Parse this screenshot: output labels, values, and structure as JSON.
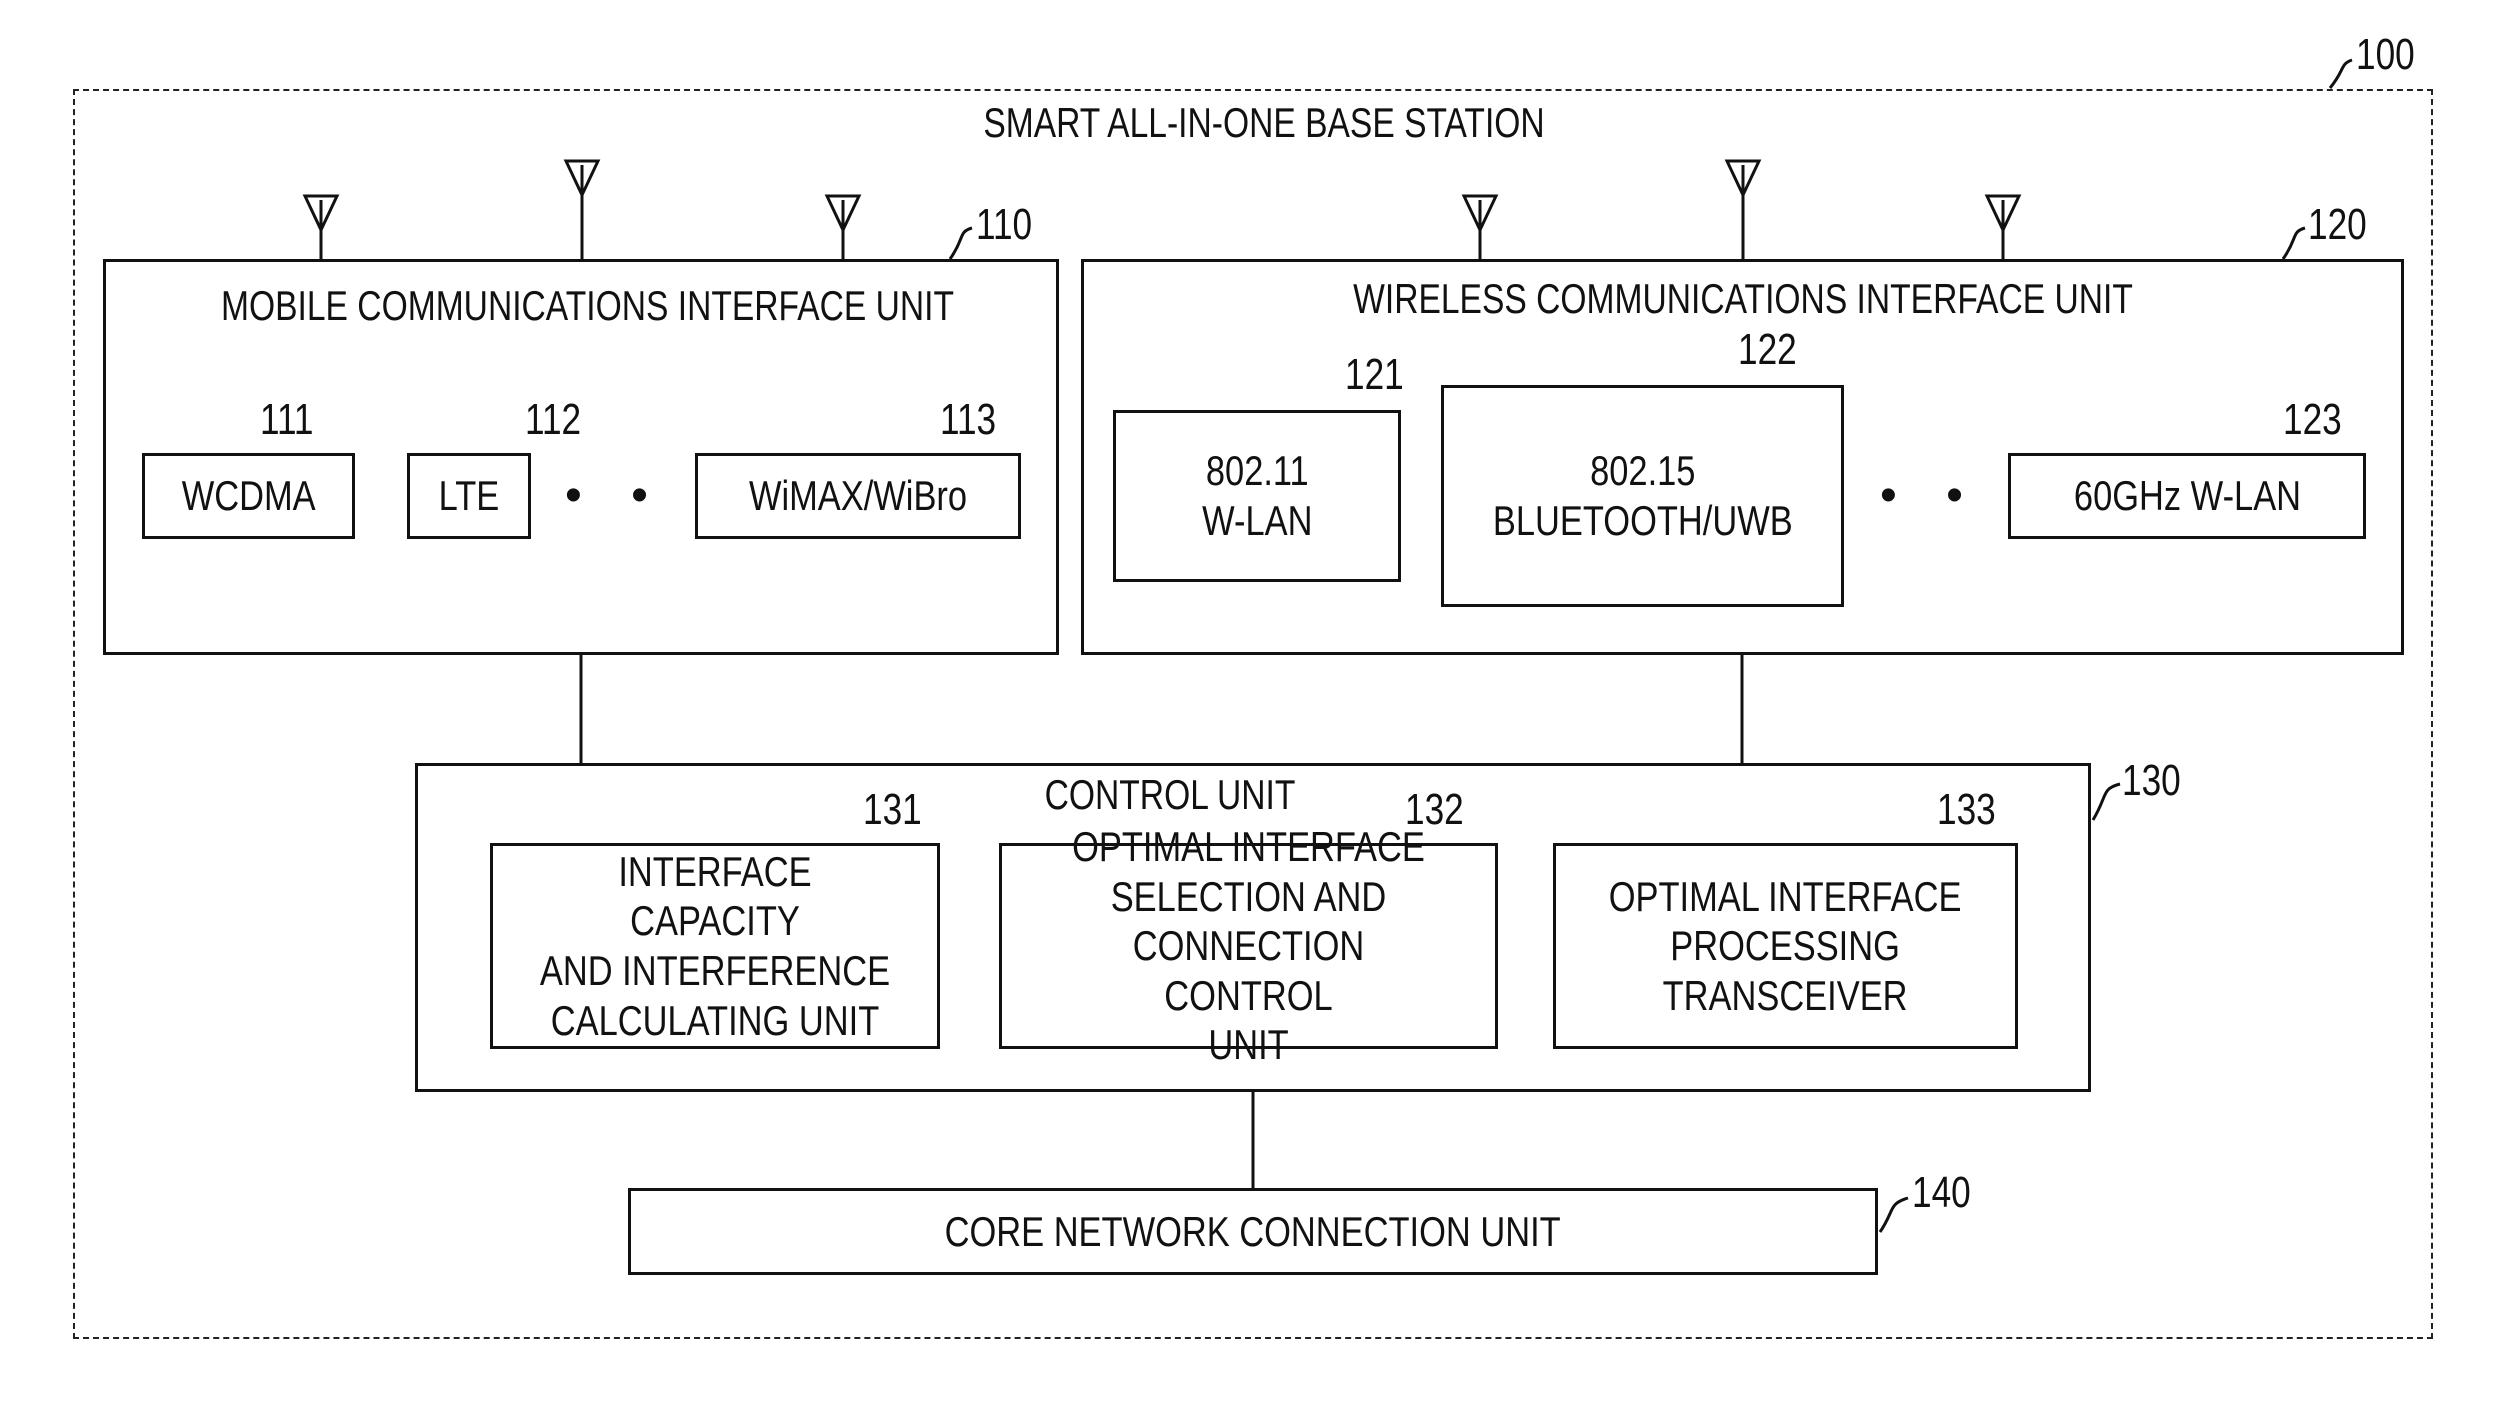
{
  "diagram": {
    "system": {
      "ref": "100",
      "title": "SMART ALL-IN-ONE BASE STATION"
    },
    "mobile_unit": {
      "ref": "110",
      "title": "MOBILE COMMUNICATIONS INTERFACE UNIT",
      "modules": [
        {
          "ref": "111",
          "label": "WCDMA"
        },
        {
          "ref": "112",
          "label": "LTE"
        },
        {
          "ref": "113",
          "label": "WiMAX/WiBro"
        }
      ],
      "ellipsis": "• • •",
      "antenna_count": 3
    },
    "wireless_unit": {
      "ref": "120",
      "title": "WIRELESS COMMUNICATIONS INTERFACE UNIT",
      "modules": [
        {
          "ref": "121",
          "label": "802.11\nW-LAN"
        },
        {
          "ref": "122",
          "label": "802.15\nBLUETOOTH/UWB"
        },
        {
          "ref": "123",
          "label": "60GHz W-LAN"
        }
      ],
      "ellipsis": "• • •",
      "antenna_count": 3
    },
    "control_unit": {
      "ref": "130",
      "title": "CONTROL UNIT",
      "modules": [
        {
          "ref": "131",
          "label": "INTERFACE CAPACITY\nAND INTERFERENCE\nCALCULATING UNIT"
        },
        {
          "ref": "132",
          "label": "OPTIMAL INTERFACE\nSELECTION AND\nCONNECTION CONTROL\nUNIT"
        },
        {
          "ref": "133",
          "label": "OPTIMAL INTERFACE\nPROCESSING\nTRANSCEIVER"
        }
      ]
    },
    "core_unit": {
      "ref": "140",
      "label": "CORE NETWORK CONNECTION UNIT"
    }
  }
}
